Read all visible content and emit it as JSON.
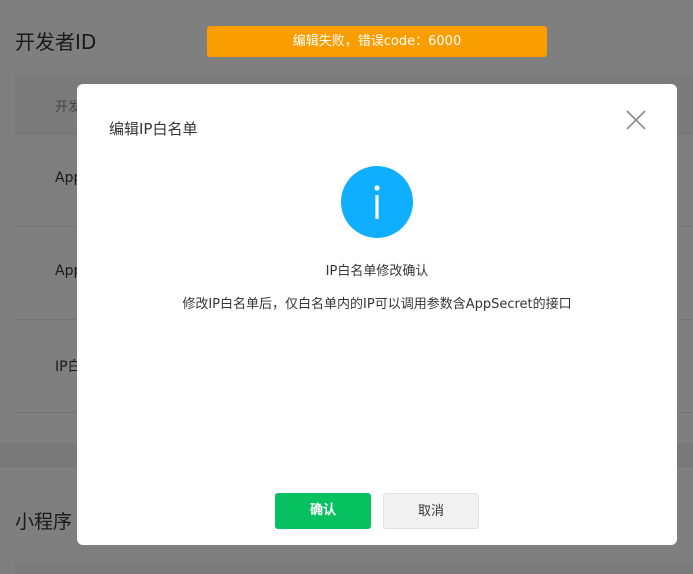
{
  "page": {
    "title": "开发者ID",
    "table_header": "开发",
    "rows": [
      {
        "label": "App"
      },
      {
        "label": "App"
      },
      {
        "label": "IP白"
      }
    ],
    "section_title": "小程序"
  },
  "toast": {
    "message": "编辑失败，错误code：6000",
    "color": "#fa9d00"
  },
  "dialog": {
    "title": "编辑IP白名单",
    "close_icon": "close-icon",
    "status_icon": "info-icon",
    "status_color": "#10aeff",
    "message_title": "IP白名单修改确认",
    "message_desc": "修改IP白名单后，仅白名单内的IP可以调用参数含AppSecret的接口",
    "confirm_label": "确认",
    "cancel_label": "取消",
    "confirm_color": "#07c160"
  }
}
